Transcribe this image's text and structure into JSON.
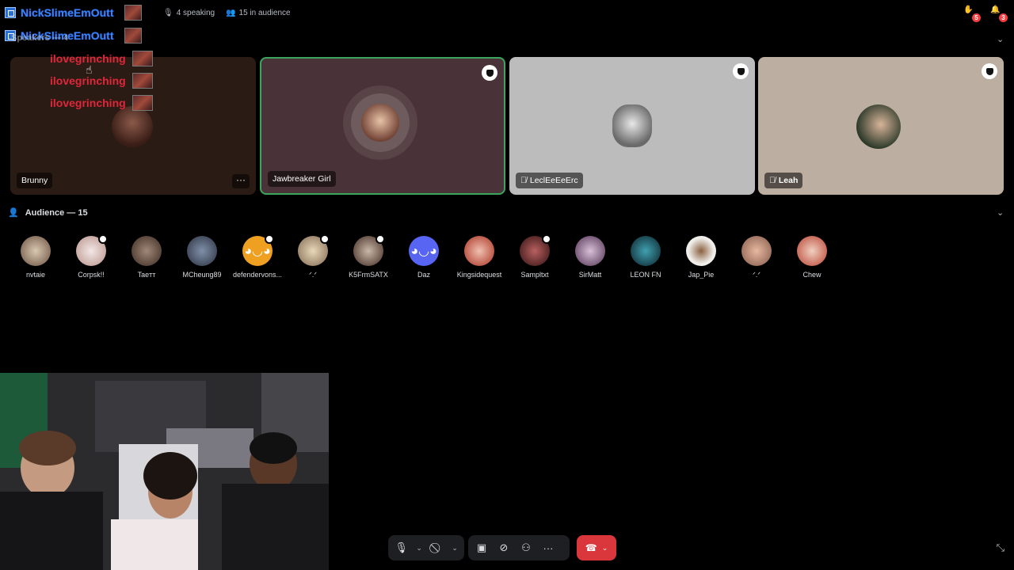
{
  "topbar": {
    "speaking": "4 speaking",
    "audience": "15 in audience",
    "hand_badge": "5",
    "notif_badge": "3"
  },
  "overlay": {
    "names": [
      "NickSlimeEmOutt",
      "NickSlimeEmOutt",
      "ilovegrinching",
      "ilovegrinching",
      "ilovegrinching"
    ]
  },
  "speakers": {
    "header": "Speakers — 4",
    "tiles": [
      {
        "name": "Brunny"
      },
      {
        "name": "Jawbreaker Girl"
      },
      {
        "name": "LeclEeEeErc"
      },
      {
        "name": "Leah"
      }
    ]
  },
  "audience": {
    "header": "Audience — 15",
    "members": [
      "nvtaie",
      "Corpsk!!",
      "Taeтт",
      "MCheung89",
      "defendervons...",
      "ᐟ.ᐟ",
      "K5FrmSATX",
      "Daz",
      "Kingsidequest",
      "Sampltxt",
      "SirMatt",
      "LEON FN",
      "Jap_Pie",
      "ᐟ.ᐟ",
      "Chew"
    ]
  },
  "colors": {
    "active_border": "#3ba55d",
    "end_call": "#da373c",
    "badge": "#f23f42"
  }
}
